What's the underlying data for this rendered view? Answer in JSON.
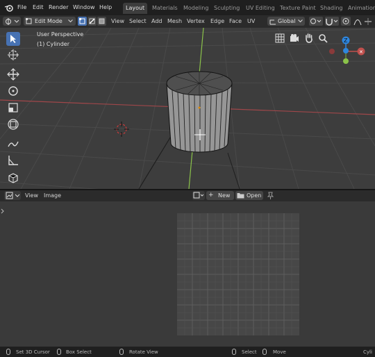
{
  "topbar": {
    "menus": [
      "File",
      "Edit",
      "Render",
      "Window",
      "Help"
    ],
    "workspaces": [
      "Layout",
      "Materials",
      "Modeling",
      "Sculpting",
      "UV Editing",
      "Texture Paint",
      "Shading",
      "Animation"
    ],
    "active_workspace": "Layout"
  },
  "viewport_header": {
    "mode": "Edit Mode",
    "menus": [
      "View",
      "Select",
      "Add",
      "Mesh",
      "Vertex",
      "Edge",
      "Face",
      "UV"
    ],
    "orientation": "Global"
  },
  "viewport": {
    "perspective_label": "User Perspective",
    "object_label": "(1) Cylinder",
    "gizmo": {
      "z_label": "Z",
      "y_label": "Y"
    }
  },
  "image_editor_header": {
    "menus": [
      "View",
      "Image"
    ],
    "new_label": "New",
    "open_label": "Open"
  },
  "statusbar": {
    "items": [
      "Set 3D Cursor",
      "Box Select",
      "Rotate View",
      "Select",
      "Move"
    ],
    "right_text": "Cyli"
  },
  "colors": {
    "accent": "#4772b3",
    "x_axis": "#c0504d",
    "y_axis": "#8bc34a",
    "z_axis": "#2e86de",
    "grid_uv": "#5d5d5d"
  }
}
